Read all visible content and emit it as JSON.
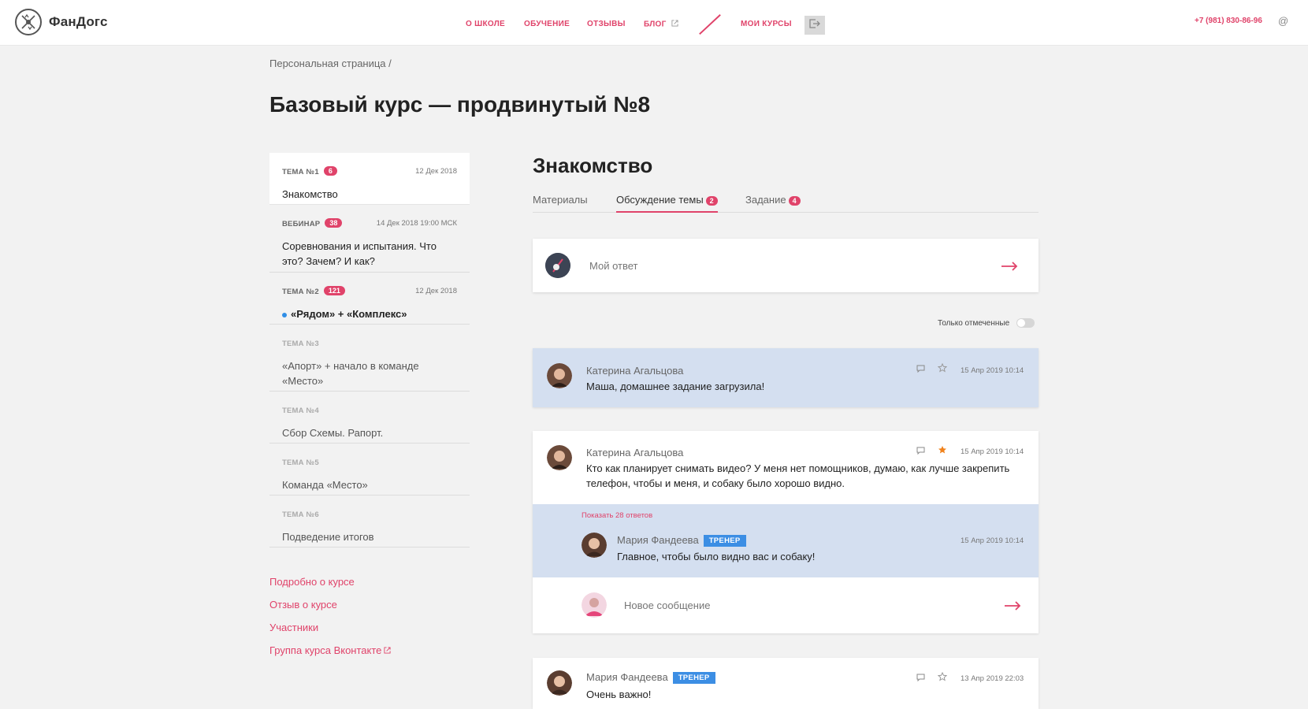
{
  "header": {
    "logo_text": "ФанДогс",
    "nav": [
      "О ШКОЛЕ",
      "ОБУЧЕНИЕ",
      "ОТЗЫВЫ",
      "БЛОГ"
    ],
    "my_courses": "МОИ КУРСЫ",
    "phone": "+7 (981) 830-86-96",
    "at": "@"
  },
  "breadcrumb": "Персональная страница  /",
  "page_title": "Базовый курс — продвинутый №8",
  "topics": [
    {
      "label": "ТЕМА №1",
      "badge": "6",
      "date": "12 Дек 2018",
      "name": "Знакомство"
    },
    {
      "label": "ВЕБИНАР",
      "badge": "38",
      "date": "14 Дек 2018 19:00 МСК",
      "name": "Соревнования и испытания. Что это? Зачем? И как?"
    },
    {
      "label": "ТЕМА №2",
      "badge": "121",
      "date": "12 Дек 2018",
      "name": "«Рядом» + «Комплекс»"
    },
    {
      "label": "ТЕМА №3",
      "name": "«Апорт» + начало в команде «Место»"
    },
    {
      "label": "ТЕМА №4",
      "name": "Сбор Схемы. Рапорт."
    },
    {
      "label": "ТЕМА №5",
      "name": "Команда «Место»"
    },
    {
      "label": "ТЕМА №6",
      "name": "Подведение итогов"
    }
  ],
  "side_links": [
    "Подробно о курсе",
    "Отзыв о курсе",
    "Участники",
    "Группа курса Вконтакте"
  ],
  "section_title": "Знакомство",
  "tabs": [
    {
      "label": "Материалы"
    },
    {
      "label": "Обсуждение темы",
      "count": "2"
    },
    {
      "label": "Задание",
      "count": "4"
    }
  ],
  "reply_placeholder": "Мой ответ",
  "filter_label": "Только отмеченные",
  "posts": [
    {
      "author": "Катерина Агальцова",
      "date": "15 Апр 2019 10:14",
      "text": "Маша, домашнее задание загрузила!"
    },
    {
      "author": "Катерина Агальцова",
      "date": "15 Апр 2019 10:14",
      "text": "Кто как планирует снимать видео? У меня нет помощников, думаю, как лучше закрепить телефон, чтобы и меня, и собаку было хорошо видно.",
      "show_replies": "Показать 28 ответов",
      "reply": {
        "author": "Мария Фандеева",
        "badge": "ТРЕНЕР",
        "date": "15 Апр 2019 10:14",
        "text": "Главное, чтобы было видно вас и собаку!"
      },
      "new_message_placeholder": "Новое сообщение"
    },
    {
      "author": "Мария Фандеева",
      "badge": "ТРЕНЕР",
      "date": "13 Апр 2019 22:03",
      "text": "Очень важно!"
    }
  ],
  "colors": {
    "accent": "#e0436a",
    "highlight": "#d4dff0",
    "trainer": "#3c8ee4",
    "star_active": "#f0821c"
  }
}
